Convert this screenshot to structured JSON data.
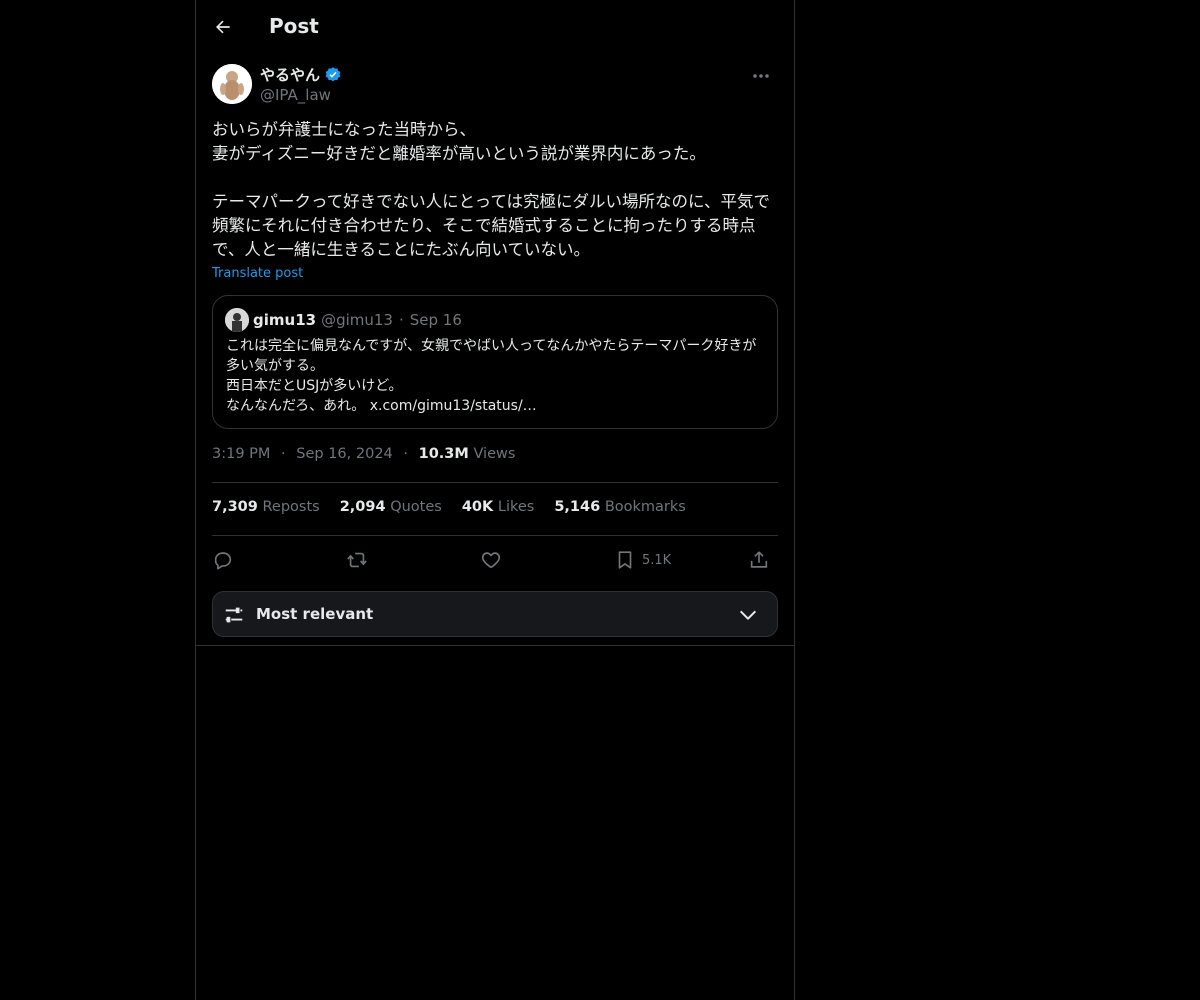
{
  "header": {
    "title": "Post"
  },
  "author": {
    "display_name": "やるやん",
    "handle": "@IPA_law"
  },
  "post": {
    "text": "おいらが弁護士になった当時から、\n妻がディズニー好きだと離婚率が高いという説が業界内にあった。\n\nテーマパークって好きでない人にとっては究極にダルい場所なのに、平気で頻繁にそれに付き合わせたり、そこで結婚式することに拘ったりする時点で、人と一緒に生きることにたぶん向いていない。",
    "translate_label": "Translate post"
  },
  "quote": {
    "name": "gimu13",
    "handle": "@gimu13",
    "separator": "·",
    "date": "Sep 16",
    "text": "これは完全に偏見なんですが、女親でやばい人ってなんかやたらテーマパーク好きが多い気がする。\n西日本だとUSJが多いけど。\nなんなんだろ、あれ。 x.com/gimu13/status/…"
  },
  "meta": {
    "time": "3:19 PM",
    "separator": "·",
    "date": "Sep 16, 2024",
    "views_count": "10.3M",
    "views_label": "Views"
  },
  "stats": {
    "reposts_count": "7,309",
    "reposts_label": "Reposts",
    "quotes_count": "2,094",
    "quotes_label": "Quotes",
    "likes_count": "40K",
    "likes_label": "Likes",
    "bookmarks_count": "5,146",
    "bookmarks_label": "Bookmarks"
  },
  "actions": {
    "bookmark_count": "5.1K"
  },
  "sort": {
    "label": "Most relevant"
  },
  "icons": {
    "back": "arrow-left-icon",
    "verified": "verified-badge-icon",
    "more": "more-dots-icon",
    "reply": "reply-icon",
    "repost": "repost-icon",
    "like": "heart-icon",
    "bookmark": "bookmark-icon",
    "share": "share-icon",
    "sort": "sliders-icon",
    "chevron": "chevron-down-icon"
  },
  "colors": {
    "background": "#000000",
    "text": "#e7e9ea",
    "muted": "#71767b",
    "accent": "#1d9bf0",
    "border": "#2f3336"
  }
}
